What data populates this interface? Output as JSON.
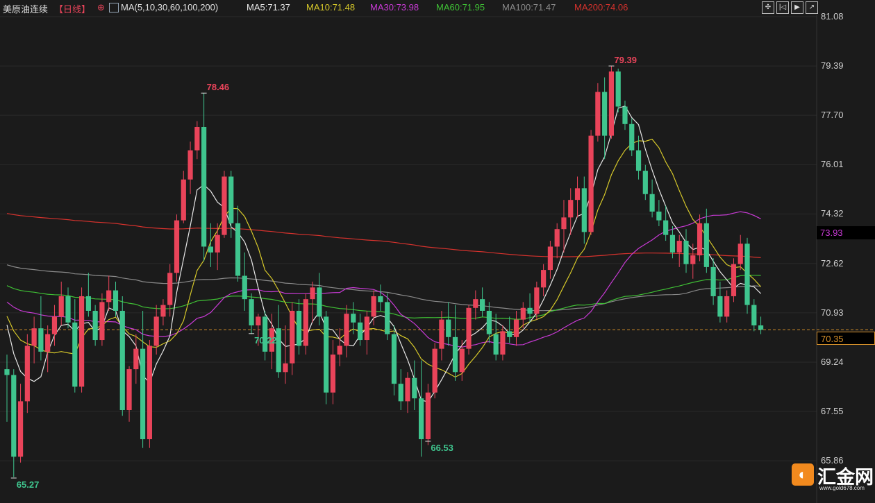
{
  "header": {
    "instrument": "美原油连续",
    "period": "【日线】",
    "settings_glyph": "⊕",
    "ma_params": "MA(5,10,30,60,100,200)",
    "ma5": "MA5:71.37",
    "ma10": "MA10:71.48",
    "ma30": "MA30:73.98",
    "ma60": "MA60:71.95",
    "ma100": "MA100:71.47",
    "ma200": "MA200:74.06"
  },
  "toolbar": {
    "buttons": [
      "fit",
      "first",
      "play",
      "export"
    ]
  },
  "price_tags": {
    "ma30_tag": "73.93",
    "last_price_tag": "70.35"
  },
  "logo": {
    "name": "汇金网",
    "url": "www.gold678.com"
  },
  "colors": {
    "up": "#e9445a",
    "down": "#3fc58e",
    "ma5": "#e8e8e8",
    "ma10": "#d7c92a",
    "ma30": "#c93ad6",
    "ma60": "#3fc135",
    "ma100": "#8a8a8a",
    "ma200": "#d6322d",
    "last_price_line": "#d8912a"
  },
  "chart_data": {
    "type": "candlestick",
    "title": "美原油连续【日线】",
    "ylim": [
      65.27,
      81.08
    ],
    "y_ticks": [
      "81.08",
      "79.39",
      "77.70",
      "76.01",
      "74.32",
      "72.62",
      "70.93",
      "69.24",
      "67.55",
      "65.86"
    ],
    "last_price": 70.35,
    "annotations": [
      {
        "label": "78.46",
        "value": 78.46,
        "type": "high"
      },
      {
        "label": "79.39",
        "value": 79.39,
        "type": "high"
      },
      {
        "label": "66.53",
        "value": 66.53,
        "type": "low"
      },
      {
        "label": "65.27",
        "value": 65.27,
        "type": "low"
      },
      {
        "label": "70.22",
        "value": 70.22,
        "type": "low"
      }
    ],
    "ohlc": [
      [
        69.0,
        69.5,
        67.2,
        68.8
      ],
      [
        68.8,
        69.0,
        65.3,
        66.0
      ],
      [
        66.0,
        68.5,
        65.8,
        67.9
      ],
      [
        67.9,
        70.2,
        67.5,
        69.8
      ],
      [
        69.8,
        70.8,
        69.2,
        70.4
      ],
      [
        70.4,
        71.5,
        69.3,
        69.6
      ],
      [
        69.6,
        70.5,
        68.9,
        70.2
      ],
      [
        70.2,
        71.2,
        69.8,
        70.8
      ],
      [
        70.8,
        72.0,
        70.5,
        71.5
      ],
      [
        71.5,
        71.8,
        70.4,
        70.6
      ],
      [
        70.6,
        71.4,
        68.2,
        68.4
      ],
      [
        68.4,
        71.8,
        68.2,
        71.5
      ],
      [
        71.5,
        72.3,
        70.8,
        71.0
      ],
      [
        71.0,
        71.2,
        69.8,
        70.0
      ],
      [
        70.0,
        71.6,
        69.8,
        71.3
      ],
      [
        71.3,
        72.2,
        71.0,
        71.7
      ],
      [
        71.7,
        72.0,
        70.8,
        71.0
      ],
      [
        71.0,
        71.5,
        67.4,
        67.6
      ],
      [
        67.6,
        69.1,
        67.2,
        69.0
      ],
      [
        69.0,
        70.2,
        68.5,
        69.7
      ],
      [
        69.7,
        71.0,
        66.3,
        66.6
      ],
      [
        66.6,
        70.0,
        66.3,
        69.8
      ],
      [
        69.8,
        71.2,
        69.5,
        70.8
      ],
      [
        70.8,
        71.4,
        70.5,
        71.2
      ],
      [
        71.2,
        72.6,
        70.8,
        72.3
      ],
      [
        72.3,
        74.3,
        72.0,
        74.1
      ],
      [
        74.1,
        75.8,
        74.0,
        75.5
      ],
      [
        75.5,
        76.8,
        75.0,
        76.5
      ],
      [
        76.5,
        77.5,
        76.2,
        77.3
      ],
      [
        77.3,
        78.46,
        72.7,
        73.2
      ],
      [
        73.2,
        74.0,
        72.5,
        73.0
      ],
      [
        73.0,
        74.0,
        72.4,
        73.6
      ],
      [
        73.6,
        75.8,
        73.5,
        75.6
      ],
      [
        75.6,
        75.8,
        73.5,
        74.0
      ],
      [
        74.0,
        74.6,
        72.0,
        72.2
      ],
      [
        72.2,
        73.0,
        71.0,
        71.4
      ],
      [
        71.4,
        71.6,
        70.2,
        70.5
      ],
      [
        70.5,
        70.9,
        69.8,
        70.8
      ],
      [
        70.8,
        71.0,
        69.3,
        69.6
      ],
      [
        69.6,
        70.9,
        69.0,
        70.4
      ],
      [
        70.4,
        71.2,
        68.7,
        68.9
      ],
      [
        68.9,
        70.5,
        68.5,
        69.2
      ],
      [
        69.2,
        71.3,
        68.8,
        71.0
      ],
      [
        71.0,
        71.4,
        69.5,
        69.8
      ],
      [
        69.8,
        71.6,
        69.5,
        71.4
      ],
      [
        71.4,
        72.0,
        70.6,
        71.8
      ],
      [
        71.8,
        72.3,
        70.5,
        70.8
      ],
      [
        70.8,
        71.0,
        67.8,
        68.2
      ],
      [
        68.2,
        70.0,
        67.8,
        69.5
      ],
      [
        69.5,
        70.4,
        69.1,
        69.8
      ],
      [
        69.8,
        71.2,
        69.4,
        70.9
      ],
      [
        70.9,
        71.3,
        70.2,
        70.6
      ],
      [
        70.6,
        70.9,
        69.8,
        70.0
      ],
      [
        70.0,
        71.0,
        69.5,
        70.8
      ],
      [
        70.8,
        71.7,
        70.5,
        71.5
      ],
      [
        71.5,
        71.9,
        71.0,
        71.3
      ],
      [
        71.3,
        71.6,
        70.0,
        70.2
      ],
      [
        70.2,
        70.5,
        68.1,
        68.5
      ],
      [
        68.5,
        69.0,
        67.6,
        67.9
      ],
      [
        67.9,
        68.9,
        67.5,
        68.7
      ],
      [
        68.7,
        69.3,
        67.6,
        68.0
      ],
      [
        68.0,
        69.3,
        66.0,
        66.6
      ],
      [
        66.6,
        68.5,
        66.4,
        68.2
      ],
      [
        68.2,
        69.9,
        68.0,
        69.7
      ],
      [
        69.7,
        71.0,
        69.3,
        70.7
      ],
      [
        70.7,
        71.3,
        69.8,
        70.1
      ],
      [
        70.1,
        71.2,
        68.6,
        68.9
      ],
      [
        68.9,
        70.0,
        68.6,
        69.7
      ],
      [
        69.7,
        71.2,
        69.5,
        71.1
      ],
      [
        71.1,
        71.7,
        70.7,
        71.4
      ],
      [
        71.4,
        71.8,
        70.8,
        71.0
      ],
      [
        71.0,
        71.3,
        69.9,
        70.2
      ],
      [
        70.2,
        70.9,
        69.3,
        69.5
      ],
      [
        69.5,
        70.5,
        69.3,
        70.3
      ],
      [
        70.3,
        70.8,
        69.9,
        70.1
      ],
      [
        70.1,
        71.0,
        69.8,
        70.7
      ],
      [
        70.7,
        71.3,
        70.4,
        71.1
      ],
      [
        71.1,
        71.6,
        70.6,
        70.9
      ],
      [
        70.9,
        72.0,
        70.7,
        71.8
      ],
      [
        71.8,
        72.6,
        71.5,
        72.4
      ],
      [
        72.4,
        73.4,
        72.1,
        73.2
      ],
      [
        73.2,
        74.0,
        72.8,
        73.8
      ],
      [
        73.8,
        74.8,
        73.0,
        74.2
      ],
      [
        74.2,
        75.2,
        73.6,
        74.8
      ],
      [
        74.8,
        75.6,
        74.2,
        75.2
      ],
      [
        75.2,
        75.6,
        73.3,
        73.7
      ],
      [
        73.7,
        77.2,
        73.6,
        77.0
      ],
      [
        77.0,
        78.8,
        76.8,
        78.5
      ],
      [
        78.5,
        79.0,
        76.2,
        77.0
      ],
      [
        77.0,
        79.39,
        76.9,
        79.2
      ],
      [
        79.2,
        79.3,
        77.8,
        78.0
      ],
      [
        78.0,
        78.2,
        77.2,
        77.4
      ],
      [
        77.4,
        77.6,
        76.3,
        76.5
      ],
      [
        76.5,
        77.0,
        75.5,
        75.8
      ],
      [
        75.8,
        76.0,
        74.8,
        75.0
      ],
      [
        75.0,
        75.5,
        74.2,
        74.4
      ],
      [
        74.4,
        74.8,
        73.9,
        74.1
      ],
      [
        74.1,
        74.6,
        73.4,
        73.6
      ],
      [
        73.6,
        73.9,
        72.8,
        73.0
      ],
      [
        73.0,
        73.6,
        72.5,
        73.4
      ],
      [
        73.4,
        73.8,
        72.3,
        72.6
      ],
      [
        72.6,
        73.3,
        72.1,
        72.9
      ],
      [
        72.9,
        74.3,
        72.7,
        74.0
      ],
      [
        74.0,
        74.5,
        72.3,
        72.5
      ],
      [
        72.5,
        72.8,
        71.2,
        71.5
      ],
      [
        71.5,
        72.0,
        70.6,
        70.8
      ],
      [
        70.8,
        71.7,
        70.6,
        71.5
      ],
      [
        71.5,
        72.8,
        71.3,
        72.6
      ],
      [
        72.6,
        73.6,
        72.4,
        73.3
      ],
      [
        73.3,
        73.5,
        70.9,
        71.2
      ],
      [
        71.2,
        71.4,
        70.3,
        70.5
      ],
      [
        70.5,
        70.8,
        70.2,
        70.35
      ]
    ]
  }
}
